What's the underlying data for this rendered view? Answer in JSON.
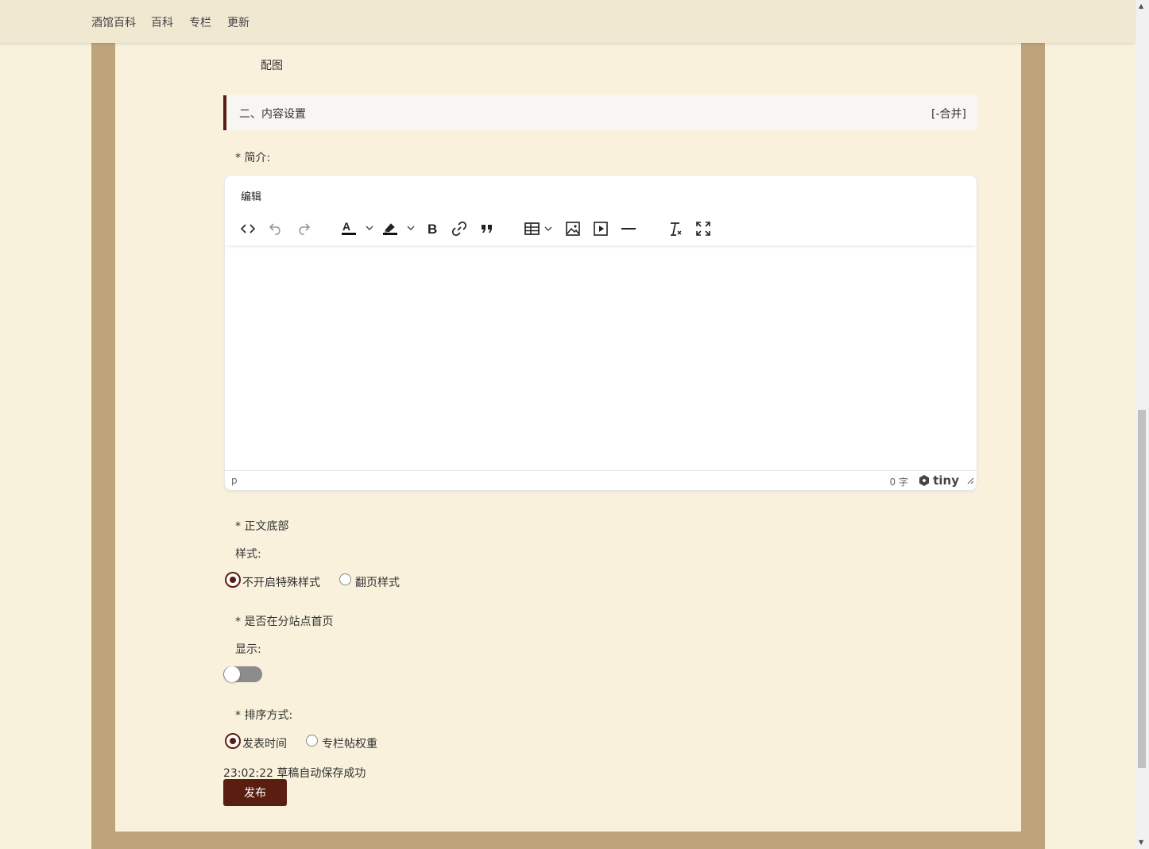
{
  "nav": {
    "items": [
      "酒馆百科",
      "百科",
      "专栏",
      "更新"
    ]
  },
  "form": {
    "image_label": "配图",
    "section": {
      "title": "二、内容设置",
      "toggle": "[-合并]"
    },
    "intro_label": "* 简介:",
    "editor": {
      "menu_edit": "编辑",
      "toolbar_icons": [
        "source-code-icon",
        "undo-icon",
        "redo-icon",
        "text-color-icon",
        "highlight-color-icon",
        "bold-icon",
        "link-icon",
        "blockquote-icon",
        "table-icon",
        "image-icon",
        "media-icon",
        "horizontal-rule-icon",
        "clear-format-icon",
        "fullscreen-icon"
      ],
      "status_path": "p",
      "word_count": "0 字",
      "brand": "tiny"
    },
    "footer_style": {
      "label": "* 正文底部",
      "sublabel": "样式:",
      "options": [
        "不开启特殊样式",
        "翻页样式"
      ],
      "selected": "不开启特殊样式"
    },
    "homepage": {
      "label": "* 是否在分站点首页",
      "sublabel": "显示:",
      "toggle_on": false
    },
    "sort": {
      "label": "* 排序方式:",
      "options": [
        "发表时间",
        "专栏帖权重"
      ],
      "selected": "发表时间"
    },
    "autosave_status": "23:02:22 草稿自动保存成功",
    "publish_label": "发布"
  },
  "colors": {
    "accent": "#5a1e10",
    "page_bg": "#f8f1dc",
    "frame": "#bea47b",
    "nav_bg": "#f1e8d2"
  }
}
